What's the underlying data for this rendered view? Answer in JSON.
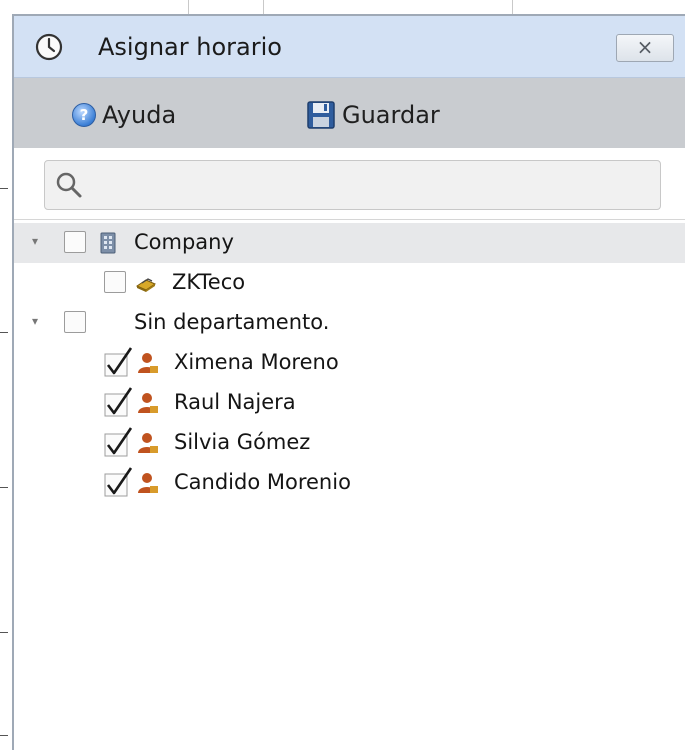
{
  "dialog": {
    "title": "Asignar horario",
    "close_label": "×"
  },
  "toolbar": {
    "help_label": "Ayuda",
    "save_label": "Guardar"
  },
  "search": {
    "placeholder": "",
    "value": ""
  },
  "tree": {
    "nodes": [
      {
        "label": "Company",
        "icon": "building-icon",
        "checked": false,
        "expanded": true,
        "selected": true
      },
      {
        "label": "ZKTeco",
        "icon": "department-icon",
        "checked": false
      },
      {
        "label": "Sin departamento.",
        "checked": false,
        "expanded": true
      },
      {
        "label": "Ximena Moreno",
        "icon": "user-icon",
        "checked": true
      },
      {
        "label": "Raul Najera",
        "icon": "user-icon",
        "checked": true
      },
      {
        "label": "Silvia Gómez",
        "icon": "user-icon",
        "checked": true
      },
      {
        "label": "Candido Morenio",
        "icon": "user-icon",
        "checked": true
      }
    ]
  },
  "colors": {
    "titlebar_bg": "#d3e1f4",
    "toolbar_bg": "#c9ccd0",
    "selected_row_bg": "#e7e8ea",
    "user_icon": "#c0531f"
  }
}
